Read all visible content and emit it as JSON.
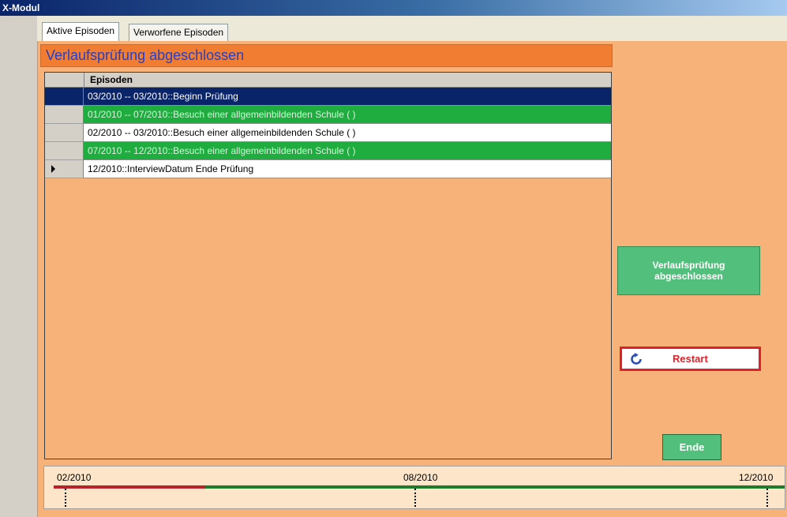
{
  "window": {
    "title": "X-Modul"
  },
  "tabs": [
    {
      "label": "Aktive Episoden",
      "active": true
    },
    {
      "label": "Verworfene Episoden",
      "active": false
    }
  ],
  "header": {
    "title": "Verlaufsprüfung abgeschlossen"
  },
  "grid": {
    "column_header": "Episoden",
    "rows": [
      {
        "text": "03/2010 -- 03/2010::Beginn Prüfung",
        "style": "selected-blue"
      },
      {
        "text": "01/2010 -- 07/2010::Besuch einer allgemeinbildenden Schule (  )",
        "style": "green"
      },
      {
        "text": "02/2010 -- 03/2010::Besuch einer allgemeinbildenden Schule (  )",
        "style": "white"
      },
      {
        "text": "07/2010 -- 12/2010::Besuch einer allgemeinbildenden Schule (  )",
        "style": "green"
      },
      {
        "text": "12/2010::InterviewDatum Ende Prüfung",
        "style": "white"
      }
    ]
  },
  "buttons": {
    "verlauf_label": "Verlaufsprüfung\nabgeschlossen",
    "restart_label": "Restart",
    "ende_label": "Ende"
  },
  "timeline": {
    "start_label": "02/2010",
    "mid_label": "08/2010",
    "end_label": "12/2010"
  },
  "colors": {
    "panel_bg": "#f7b279",
    "header_bg": "#f07d32",
    "header_text": "#2540c8",
    "selected_row": "#0a246a",
    "green_row": "#1fad3f",
    "button_green": "#53bf7c",
    "restart_red": "#e0202a",
    "timeline_red": "#b8222a",
    "timeline_green": "#1e7a2c"
  },
  "icons": {
    "restart": "refresh-icon",
    "current_row": "row-pointer-icon"
  }
}
